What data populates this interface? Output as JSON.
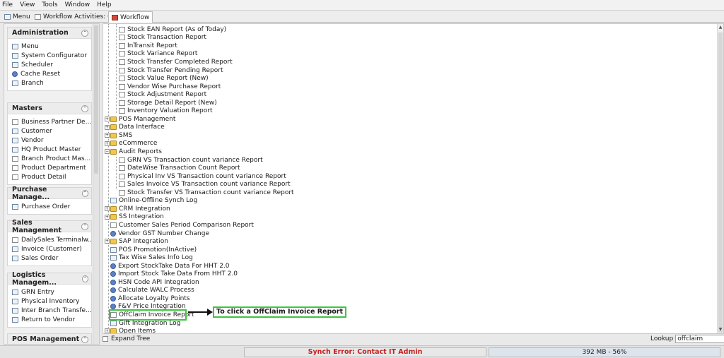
{
  "menubar": [
    "File",
    "View",
    "Tools",
    "Window",
    "Help"
  ],
  "tabs": [
    {
      "label": "Menu",
      "icon": "home-icon"
    },
    {
      "label": "Workflow Activities: 0",
      "icon": "workflow-activities-icon"
    },
    {
      "label": "Workflow",
      "icon": "workflow-icon"
    }
  ],
  "sidebar": {
    "sections": [
      {
        "title": "Administration",
        "items": [
          "Menu",
          "System Configurator",
          "Scheduler",
          "Cache Reset",
          "Branch"
        ]
      },
      {
        "title": "Masters",
        "items": [
          "Business Partner De...",
          "Customer",
          "Vendor",
          "HQ Product Master",
          "Branch Product Mas...",
          "Product Department",
          "Product Detail"
        ]
      },
      {
        "title": "Purchase Manage...",
        "items": [
          "Purchase Order"
        ]
      },
      {
        "title": "Sales Management",
        "items": [
          "DailySales Terminalw...",
          "Invoice (Customer)",
          "Sales Order"
        ]
      },
      {
        "title": "Logistics Managem...",
        "items": [
          "GRN Entry",
          "Physical Inventory",
          "Inter Branch Transfe...",
          "Return to Vendor"
        ]
      },
      {
        "title": "POS Management",
        "items": []
      }
    ]
  },
  "tree": {
    "rows": [
      {
        "label": "Stock EAN Report (As of Today)",
        "type": "report"
      },
      {
        "label": "Stock Transaction Report",
        "type": "report"
      },
      {
        "label": "InTransit Report",
        "type": "report"
      },
      {
        "label": "Stock Variance Report",
        "type": "report"
      },
      {
        "label": "Stock Transfer Completed Report",
        "type": "report"
      },
      {
        "label": "Stock Transfer Pending Report",
        "type": "report"
      },
      {
        "label": "Stock Value Report (New)",
        "type": "report"
      },
      {
        "label": "Vendor Wise Purchase Report",
        "type": "report"
      },
      {
        "label": "Stock Adjustment Report",
        "type": "report"
      },
      {
        "label": "Storage Detail Report (New)",
        "type": "report"
      },
      {
        "label": "Inventory Valuation Report",
        "type": "report"
      },
      {
        "label": "POS Management",
        "type": "folder"
      },
      {
        "label": "Data Interface",
        "type": "folder"
      },
      {
        "label": "SMS",
        "type": "folder"
      },
      {
        "label": "eCommerce",
        "type": "folder"
      },
      {
        "label": "Audit Reports",
        "type": "folder-open"
      },
      {
        "label": "GRN VS Transaction count variance Report",
        "type": "report"
      },
      {
        "label": "DateWise Transaction Count Report",
        "type": "report"
      },
      {
        "label": "Physical Inv VS Transaction count variance Report",
        "type": "report"
      },
      {
        "label": "Sales Invoice VS Transaction count variance Report",
        "type": "report"
      },
      {
        "label": "Stock Transfer VS Transaction count variance Report",
        "type": "report"
      },
      {
        "label": "Online-Offline Synch Log",
        "type": "window"
      },
      {
        "label": "CRM Integration",
        "type": "folder"
      },
      {
        "label": "SS Integration",
        "type": "folder"
      },
      {
        "label": "Customer Sales Period Comparison Report",
        "type": "report"
      },
      {
        "label": "Vendor GST Number Change",
        "type": "process"
      },
      {
        "label": "SAP Integration",
        "type": "folder"
      },
      {
        "label": "POS Promotion(InActive)",
        "type": "window"
      },
      {
        "label": "Tax Wise Sales Info Log",
        "type": "window"
      },
      {
        "label": "Export StockTake Data For HHT 2.0",
        "type": "process"
      },
      {
        "label": "Import Stock Take Data From HHT 2.0",
        "type": "process"
      },
      {
        "label": "HSN Code API Integration",
        "type": "process"
      },
      {
        "label": "Calculate WALC Process",
        "type": "process"
      },
      {
        "label": "Allocate Loyalty Points",
        "type": "process"
      },
      {
        "label": "F&V Price Integration",
        "type": "process"
      },
      {
        "label": "OffClaim Invoice Report",
        "type": "report"
      },
      {
        "label": "Gift Integration Log",
        "type": "window"
      },
      {
        "label": "Open Items",
        "type": "folder"
      }
    ]
  },
  "annotation": "To click a OffClaim Invoice Report",
  "expand_tree_label": "Expand Tree",
  "lookup": {
    "label": "Lookup",
    "value": "offclaim"
  },
  "status": {
    "error": "Synch Error: Contact IT Admin",
    "memory": "392 MB - 56%"
  },
  "colors": {
    "highlight": "#3fc43f",
    "error_text": "#c62020"
  }
}
